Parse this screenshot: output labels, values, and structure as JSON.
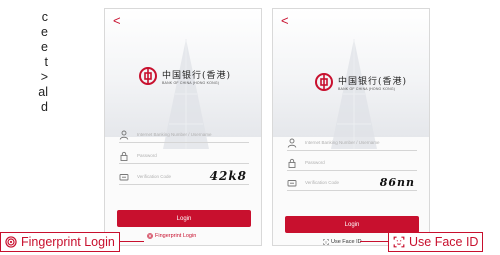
{
  "side_text": [
    "c",
    "e",
    "e",
    "t",
    ">",
    "al",
    "d"
  ],
  "left_screen": {
    "back": "<",
    "bank_name_cn": "中国银行(香港)",
    "bank_name_en": "BANK OF CHINA (HONG KONG)",
    "username_placeholder": "Internet Banking Number / Username",
    "password_placeholder": "Password",
    "verification_placeholder": "Verification Code",
    "captcha": "42k8",
    "login_label": "Login",
    "alt_login_label": "Fingerprint Login"
  },
  "right_screen": {
    "back": "<",
    "bank_name_cn": "中国银行(香港)",
    "bank_name_en": "BANK OF CHINA (HONG KONG)",
    "username_placeholder": "Internet Banking Number / Username",
    "password_placeholder": "Password",
    "verification_placeholder": "Verification Code",
    "captcha": "86nn",
    "login_label": "Login",
    "alt_login_label": "Use Face ID"
  },
  "callouts": {
    "fingerprint": "Fingerprint Login",
    "face_id": "Use Face ID"
  },
  "colors": {
    "brand_red": "#c8102e",
    "field_line": "#d5d5d5"
  },
  "icons": [
    "user-icon",
    "lock-icon",
    "shield-code-icon",
    "fingerprint-icon",
    "face-id-icon",
    "boc-logo-icon"
  ]
}
